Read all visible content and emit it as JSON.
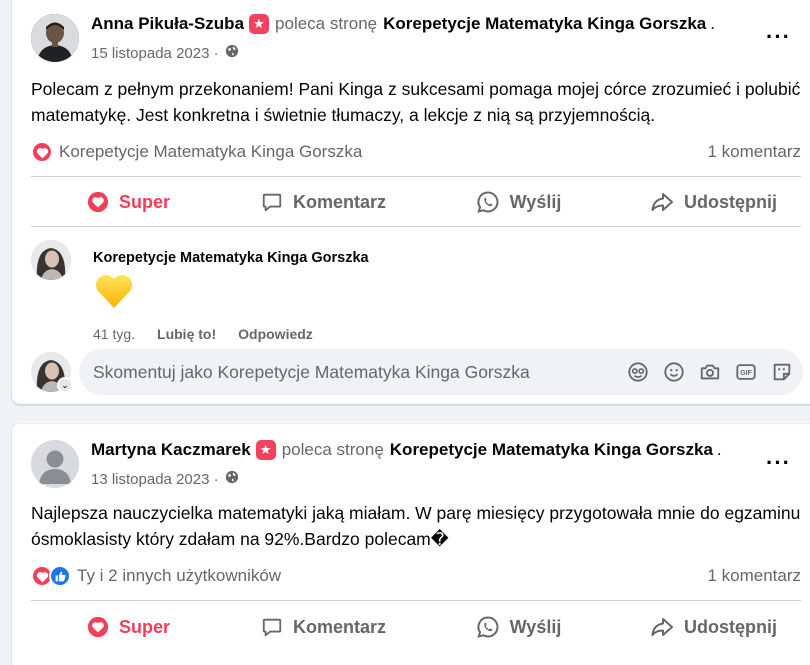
{
  "posts": [
    {
      "author": "Anna Pikuła-Szuba",
      "recommends": "poleca stronę",
      "page": "Korepetycje Matematyka Kinga Gorszka",
      "page_suffix": ".",
      "date": "15 listopada 2023 ·",
      "text": "Polecam z pełnym przekonaniem! Pani Kinga z sukcesami pomaga mojej córce zrozumieć i polubić matematykę. Jest konkretna i świetnie tłumaczy, a lekcje z nią są przyjemnością.",
      "reactions_label": "Korepetycje Matematyka Kinga Gorszka",
      "comment_count": "1 komentarz",
      "actions": {
        "react": "Super",
        "comment": "Komentarz",
        "send": "Wyślij",
        "share": "Udostępnij"
      },
      "comment": {
        "author": "Korepetycje Matematyka Kinga Gorszka",
        "emoji": "yellow-heart",
        "time": "41 tyg.",
        "like": "Lubię to!",
        "reply": "Odpowiedz"
      },
      "write_placeholder": "Skomentuj jako Korepetycje Matematyka Kinga Gorszka"
    },
    {
      "author": "Martyna Kaczmarek",
      "recommends": "poleca stronę",
      "page": "Korepetycje Matematyka Kinga Gorszka",
      "page_suffix": ".",
      "date": "13 listopada 2023 ·",
      "text": "Najlepsza nauczycielka matematyki jaką miałam. W parę miesięcy przygotowała mnie do egzaminu ósmoklasisty który zdałam na 92%.Bardzo polecam�",
      "reactions_label": "Ty i 2 innych użytkowników",
      "comment_count": "1 komentarz",
      "actions": {
        "react": "Super",
        "comment": "Komentarz",
        "send": "Wyślij",
        "share": "Udostępnij"
      }
    }
  ],
  "colors": {
    "accent": "#f33e58",
    "like": "#1877f2",
    "muted": "#65676b",
    "background": "#f0f2f5"
  },
  "icons": [
    "more-icon",
    "globe-icon",
    "heart-icon",
    "like-icon",
    "comment-icon",
    "whatsapp-icon",
    "share-icon",
    "sticker-icon",
    "smile-icon",
    "camera-icon",
    "gif-icon",
    "avatar-sticker-icon"
  ]
}
